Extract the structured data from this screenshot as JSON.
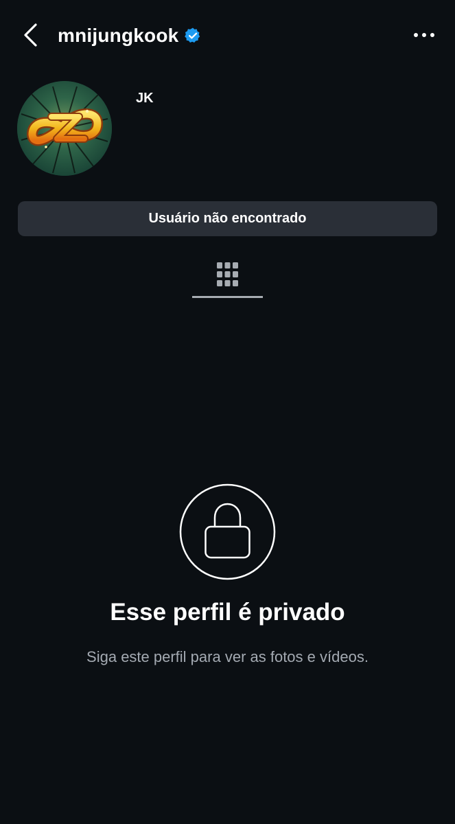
{
  "header": {
    "username": "mnijungkook",
    "verified_icon": "verified-badge-icon",
    "back_icon": "chevron-left-icon",
    "more_icon": "more-horizontal-icon"
  },
  "profile": {
    "display_name": "JK",
    "avatar_icon": "avatar-logo-icon"
  },
  "notice": {
    "text": "Usuário não encontrado"
  },
  "tabs": {
    "active_icon": "grid-icon"
  },
  "private_state": {
    "icon": "lock-icon",
    "title": "Esse perfil é privado",
    "subtitle": "Siga este perfil para ver as fotos e vídeos."
  },
  "colors": {
    "background": "#0b0f13",
    "notice_bg": "#2a2f37",
    "verified": "#1d9bf0",
    "secondary_text": "#a4aab2"
  }
}
